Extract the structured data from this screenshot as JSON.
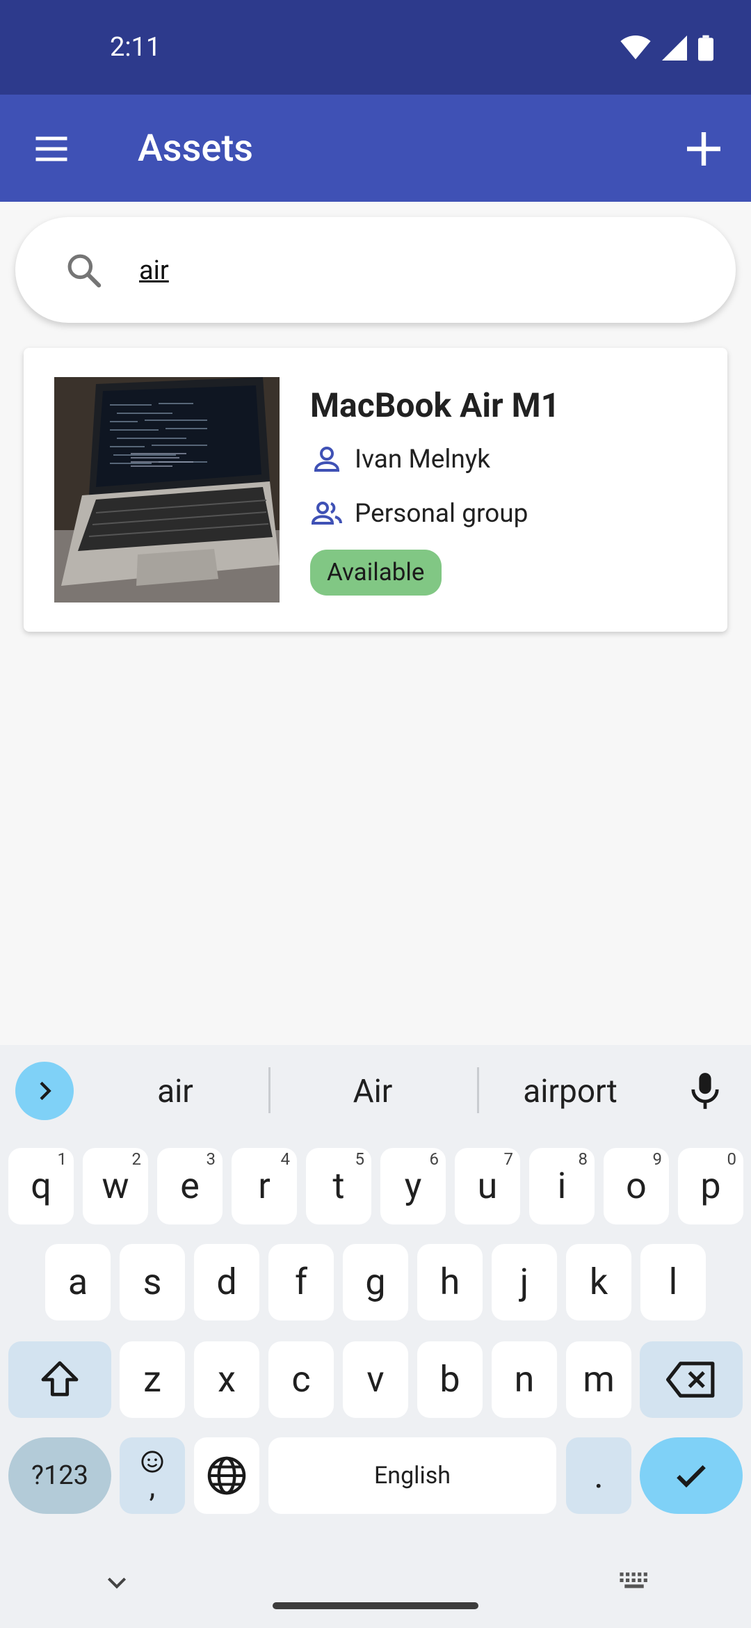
{
  "status_bar": {
    "time": "2:11"
  },
  "app_bar": {
    "title": "Assets"
  },
  "search": {
    "value": "air"
  },
  "assets": [
    {
      "name": "MacBook Air M1",
      "owner": "Ivan Melnyk",
      "group": "Personal group",
      "status": "Available",
      "status_color": "#81c784"
    }
  ],
  "fab": {
    "icon": "rfid-scan-icon",
    "color": "#ff9800"
  },
  "keyboard": {
    "suggestions": [
      "air",
      "Air",
      "airport"
    ],
    "row1": [
      {
        "key": "q",
        "hint": "1"
      },
      {
        "key": "w",
        "hint": "2"
      },
      {
        "key": "e",
        "hint": "3"
      },
      {
        "key": "r",
        "hint": "4"
      },
      {
        "key": "t",
        "hint": "5"
      },
      {
        "key": "y",
        "hint": "6"
      },
      {
        "key": "u",
        "hint": "7"
      },
      {
        "key": "i",
        "hint": "8"
      },
      {
        "key": "o",
        "hint": "9"
      },
      {
        "key": "p",
        "hint": "0"
      }
    ],
    "row2": [
      "a",
      "s",
      "d",
      "f",
      "g",
      "h",
      "j",
      "k",
      "l"
    ],
    "row3": [
      "z",
      "x",
      "c",
      "v",
      "b",
      "n",
      "m"
    ],
    "symbols_key": "?123",
    "emoji_comma_key": ",",
    "space_key": "English",
    "period_key": "."
  },
  "colors": {
    "status_bar": "#2d3a8c",
    "app_bar": "#3f51b5",
    "accent": "#7fd1f7"
  }
}
